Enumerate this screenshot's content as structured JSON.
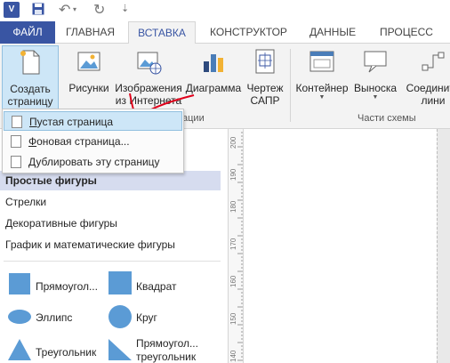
{
  "app": {
    "logo_text": "V"
  },
  "tabs": {
    "file": "ФАЙЛ",
    "home": "ГЛАВНАЯ",
    "insert": "ВСТАВКА",
    "design": "КОНСТРУКТОР",
    "data": "ДАННЫЕ",
    "process": "ПРОЦЕСС"
  },
  "ribbon": {
    "create_page": {
      "line1": "Создать",
      "line2": "страницу"
    },
    "pictures": "Рисунки",
    "online_images": {
      "line1": "Изображения",
      "line2": "из Интернета"
    },
    "chart": "Диаграмма",
    "cad_drawing": {
      "line1": "Чертеж",
      "line2": "САПР"
    },
    "container": "Контейнер",
    "callout": "Выноска",
    "connector": {
      "line1": "Соедините",
      "line2": "лини"
    },
    "group_illustrations_partial": "ации",
    "group_diagram_parts": "Части схемы"
  },
  "dropdown": {
    "items": [
      {
        "label": "Пустая страница",
        "accel": "П",
        "rest": "устая страница"
      },
      {
        "label": "Фоновая страница...",
        "accel": "Ф",
        "rest": "оновая страница..."
      },
      {
        "label": "Дублировать эту страницу",
        "accel": "Д",
        "rest": "ублировать эту страницу"
      }
    ]
  },
  "shapes_pane": {
    "categories": [
      "Простые фигуры",
      "Стрелки",
      "Декоративные фигуры",
      "График и математические фигуры"
    ],
    "shapes": [
      {
        "label": "Прямоугол..."
      },
      {
        "label": "Квадрат"
      },
      {
        "label": "Эллипс"
      },
      {
        "label": "Круг"
      },
      {
        "label": "Треугольник"
      },
      {
        "line1": "Прямоугол...",
        "line2": "треугольник"
      }
    ]
  },
  "ruler": {
    "marks": [
      "200",
      "190",
      "180",
      "170",
      "160",
      "150",
      "140"
    ]
  },
  "colors": {
    "accent": "#3955a3",
    "shape_fill": "#5b9bd5",
    "highlight": "#cde6f7",
    "annotation": "#e0001b"
  }
}
